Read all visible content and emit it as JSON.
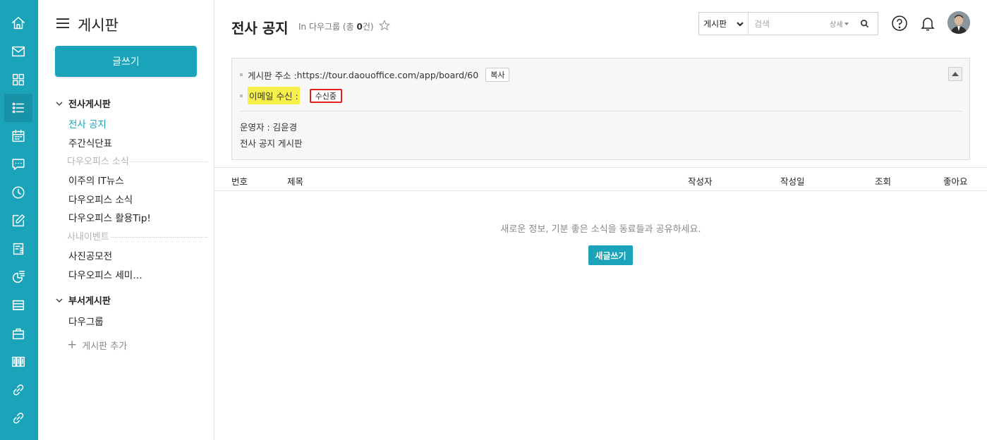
{
  "colors": {
    "accent": "#1ba4b9",
    "highlight": "#f7f04a",
    "alert_border": "#e0201b"
  },
  "rail": {
    "items": [
      {
        "icon": "home-icon"
      },
      {
        "icon": "mail-icon"
      },
      {
        "icon": "apps-grid-icon"
      },
      {
        "icon": "board-list-icon",
        "active": true
      },
      {
        "icon": "calendar-icon"
      },
      {
        "icon": "chat-icon"
      },
      {
        "icon": "clock-icon"
      },
      {
        "icon": "edit-icon"
      },
      {
        "icon": "report-icon"
      },
      {
        "icon": "survey-icon"
      },
      {
        "icon": "docs-icon"
      },
      {
        "icon": "briefcase-icon"
      },
      {
        "icon": "library-icon"
      },
      {
        "icon": "link-icon"
      },
      {
        "icon": "link-icon-2"
      }
    ]
  },
  "sidebar": {
    "title": "게시판",
    "write_button": "글쓰기",
    "sections": [
      {
        "label": "전사게시판",
        "items": [
          {
            "label": "전사 공지",
            "active": true
          },
          {
            "label": "주간식단표"
          }
        ],
        "groups": [
          {
            "label": "다우오피스 소식",
            "items": [
              "이주의 IT뉴스",
              "다우오피스 소식",
              "다우오피스 활용Tip!"
            ]
          },
          {
            "label": "사내이벤트",
            "items": [
              "사진공모전",
              "다우오피스 세미…"
            ]
          }
        ]
      },
      {
        "label": "부서게시판",
        "items": [
          {
            "label": "다우그룹"
          }
        ]
      }
    ],
    "add_board": "게시판 추가"
  },
  "header": {
    "title": "전사 공지",
    "subtitle_prefix": "In 다우그룹 (총 ",
    "subtitle_count": "0",
    "subtitle_suffix": "건)",
    "search": {
      "scope": "게시판",
      "placeholder": "검색",
      "detail": "상세"
    }
  },
  "info": {
    "address_label": "게시판 주소 :",
    "address_value": "https://tour.daouoffice.com/app/board/60",
    "copy_button": "복사",
    "email_label": "이메일 수신 :",
    "email_status_button": "수신중",
    "manager": "운영자 : 김윤경",
    "description": "전사 공지 게시판"
  },
  "table": {
    "headers": [
      "번호",
      "제목",
      "작성자",
      "작성일",
      "조회",
      "좋아요"
    ],
    "empty_message": "새로운 정보, 기분 좋은 소식을 동료들과 공유하세요.",
    "new_post_button": "새글쓰기"
  }
}
